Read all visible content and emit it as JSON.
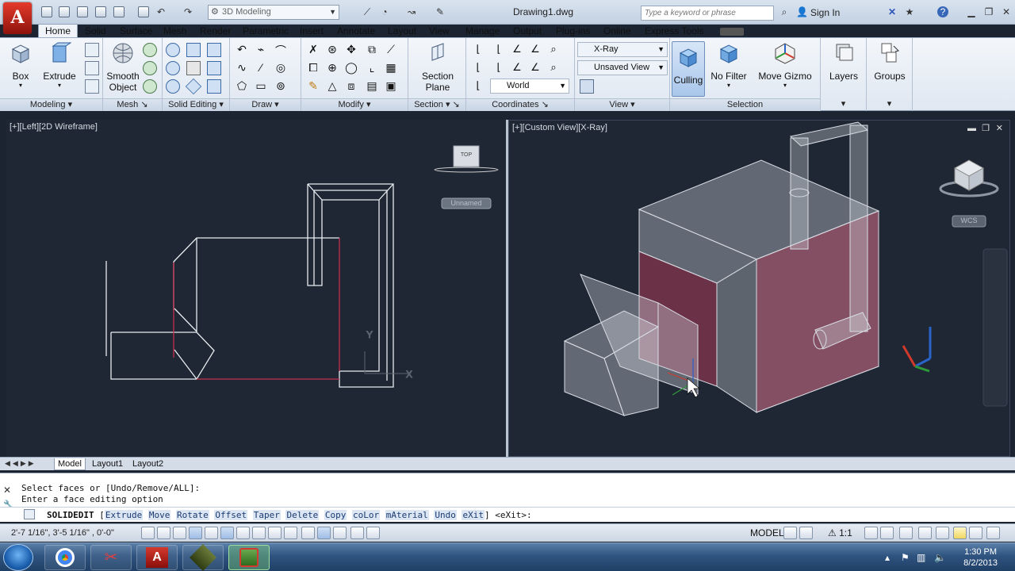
{
  "window": {
    "app_logo": "A",
    "workspace": "3D Modeling",
    "doc_title": "Drawing1.dwg",
    "search_placeholder": "Type a keyword or phrase",
    "signin": "Sign In",
    "help": "?"
  },
  "tabs": [
    "Home",
    "Solid",
    "Surface",
    "Mesh",
    "Render",
    "Parametric",
    "Insert",
    "Annotate",
    "Layout",
    "View",
    "Manage",
    "Output",
    "Plug-ins",
    "Online",
    "Express Tools"
  ],
  "ribbon": {
    "modeling": {
      "title": "Modeling",
      "box": "Box",
      "extrude": "Extrude"
    },
    "mesh": {
      "title": "Mesh",
      "smooth_1": "Smooth",
      "smooth_2": "Object"
    },
    "solid_editing": {
      "title": "Solid Editing"
    },
    "draw": {
      "title": "Draw"
    },
    "modify": {
      "title": "Modify"
    },
    "section": {
      "title": "Section",
      "plane_1": "Section",
      "plane_2": "Plane"
    },
    "coordinates": {
      "title": "Coordinates",
      "ucs": "World"
    },
    "view": {
      "title": "View",
      "visual_style": "X-Ray",
      "saved_view": "Unsaved View"
    },
    "selection": {
      "title": "Selection",
      "culling": "Culling",
      "no_filter": "No Filter",
      "move_gizmo": "Move Gizmo"
    },
    "layers": {
      "title": "Layers"
    },
    "groups": {
      "title": "Groups"
    }
  },
  "viewports": {
    "left": {
      "label": "[+][Left][2D Wireframe]",
      "viewcube": "TOP",
      "named_view": "Unnamed"
    },
    "right": {
      "label": "[+][Custom View][X-Ray]",
      "wcs": "WCS"
    }
  },
  "layout_tabs": [
    "Model",
    "Layout1",
    "Layout2"
  ],
  "command": {
    "history_1": "Select faces or [Undo/Remove/ALL]:",
    "history_2": "Enter a face editing option",
    "cmd_name": "SOLIDEDIT",
    "options": [
      "Extrude",
      "Move",
      "Rotate",
      "Offset",
      "Taper",
      "Delete",
      "Copy",
      "coLor",
      "mAterial",
      "Undo",
      "eXit"
    ],
    "default": "<eXit>:"
  },
  "status": {
    "coords": "2'-7 1/16\",  3'-5 1/16\"  , 0'-0\"",
    "model": "MODEL",
    "scale": "1:1"
  },
  "taskbar": {
    "time": "1:30 PM",
    "date": "8/2/2013"
  },
  "colors": {
    "viewport_bg": "#1f2734",
    "face_highlight": "#a23a56",
    "app_red": "#c9251a"
  }
}
